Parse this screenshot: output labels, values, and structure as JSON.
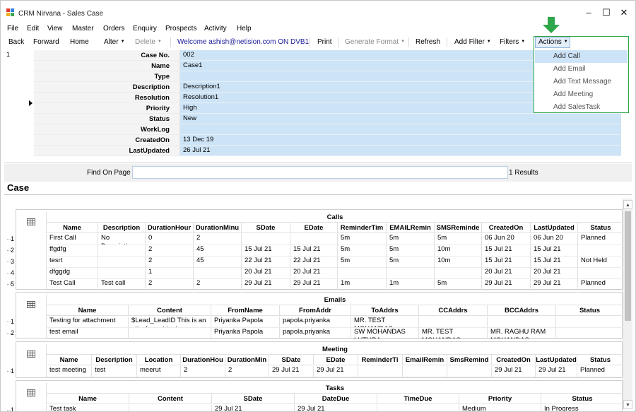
{
  "window": {
    "title": "CRM Nirvana - Sales Case",
    "minimize": "–",
    "maximize": "☐",
    "close": "✕"
  },
  "menu": [
    "File",
    "Edit",
    "View",
    "Master",
    "Orders",
    "Enquiry",
    "Prospects",
    "Activity",
    "Help"
  ],
  "toolbar": {
    "back": "Back",
    "forward": "Forward",
    "home": "Home",
    "alter": "Alter",
    "delete": "Delete",
    "welcome": "Welcome ashish@netision.com ON DVB1",
    "print": "Print",
    "generate_format": "Generate Format",
    "refresh": "Refresh",
    "add_filter": "Add Filter",
    "filters": "Filters",
    "actions": "Actions"
  },
  "actions_menu": [
    "Add Call",
    "Add Email",
    "Add Text Message",
    "Add Meeting",
    "Add SalesTask"
  ],
  "detail": {
    "row_number": "1",
    "fields": [
      {
        "label": "Case No.",
        "value": "002"
      },
      {
        "label": "Name",
        "value": "Case1"
      },
      {
        "label": "Type",
        "value": ""
      },
      {
        "label": "Description",
        "value": "Description1"
      },
      {
        "label": "Resolution",
        "value": "Resolution1"
      },
      {
        "label": "Priority",
        "value": "High"
      },
      {
        "label": "Status",
        "value": "New"
      },
      {
        "label": "WorkLog",
        "value": ""
      },
      {
        "label": "CreatedOn",
        "value": "13 Dec 19"
      },
      {
        "label": "LastUpdated",
        "value": "26 Jul 21"
      }
    ]
  },
  "find": {
    "label": "Find On Page",
    "value": "",
    "results": "1 Results"
  },
  "case_title": "Case",
  "sections": [
    {
      "title": "Calls",
      "headers": [
        "Name",
        "Description",
        "DurationHour",
        "DurationMinu",
        "SDate",
        "EDate",
        "ReminderTim",
        "EMAILRemin",
        "SMSReminde",
        "CreatedOn",
        "LastUpdated",
        "Status"
      ],
      "rows": [
        [
          "First Call",
          "No Description",
          "0",
          "2",
          "",
          "",
          "5m",
          "5m",
          "5m",
          "06 Jun 20",
          "06 Jun 20",
          "Planned"
        ],
        [
          "ffgdfg",
          "",
          "2",
          "45",
          "15 Jul 21",
          "15 Jul 21",
          "5m",
          "5m",
          "10m",
          "15 Jul 21",
          "15 Jul 21",
          ""
        ],
        [
          "tesrt",
          "",
          "2",
          "45",
          "22 Jul 21",
          "22 Jul 21",
          "5m",
          "5m",
          "10m",
          "15 Jul 21",
          "15 Jul 21",
          "Not Held"
        ],
        [
          "dfggdg",
          "",
          "1",
          "",
          "20 Jul 21",
          "20 Jul 21",
          "",
          "",
          "",
          "20 Jul 21",
          "20 Jul 21",
          ""
        ],
        [
          "Test Call",
          "Test call",
          "2",
          "2",
          "29 Jul 21",
          "29 Jul 21",
          "1m",
          "1m",
          "5m",
          "29 Jul 21",
          "29 Jul 21",
          "Planned"
        ]
      ],
      "row_nums": [
        "1",
        "2",
        "3",
        "4",
        "5"
      ]
    },
    {
      "title": "Emails",
      "headers": [
        "Name",
        "Content",
        "FromName",
        "FromAddr",
        "ToAddrs",
        "CCAddrs",
        "BCCAddrs",
        "Status"
      ],
      "rows": [
        [
          "Testing for attachment",
          "$Lead_LeadID This is an attachment test",
          "Priyanka Papola",
          "papola.priyanka",
          "MR. TEST MOHANDAS",
          "",
          "",
          ""
        ],
        [
          "test email",
          "",
          "Priyanka Papola",
          "papola.priyanka",
          "SW MOHANDAS LUTHRA",
          "MR. TEST MOHANDAS",
          "MR. RAGHU RAM MOHANDAS",
          ""
        ]
      ],
      "row_nums": [
        "1",
        "2"
      ]
    },
    {
      "title": "Meeting",
      "headers": [
        "Name",
        "Description",
        "Location",
        "DurationHou",
        "DurationMin",
        "SDate",
        "EDate",
        "ReminderTi",
        "EmailRemin",
        "SmsRemind",
        "CreatedOn",
        "LastUpdated",
        "Status"
      ],
      "rows": [
        [
          "test meeting",
          "test",
          "meerut",
          "2",
          "2",
          "29 Jul 21",
          "29 Jul 21",
          "",
          "",
          "",
          "29 Jul 21",
          "29 Jul 21",
          "Planned"
        ]
      ],
      "row_nums": [
        "1"
      ]
    },
    {
      "title": "Tasks",
      "headers": [
        "Name",
        "Content",
        "SDate",
        "DateDue",
        "TimeDue",
        "Priority",
        "Status"
      ],
      "rows": [
        [
          "Test task",
          "",
          "29 Jul 21",
          "29 Jul 21",
          "",
          "Medium",
          "In Progress"
        ]
      ],
      "row_nums": [
        "1"
      ]
    }
  ],
  "colors": {
    "field_bg": "#cde4f7",
    "dropdown_border": "#2ea64a",
    "arrow": "#2ea64a"
  },
  "icons": {
    "app": "app-logo-icon",
    "arrow": "down-arrow-icon",
    "grid": "table-grid-icon"
  }
}
